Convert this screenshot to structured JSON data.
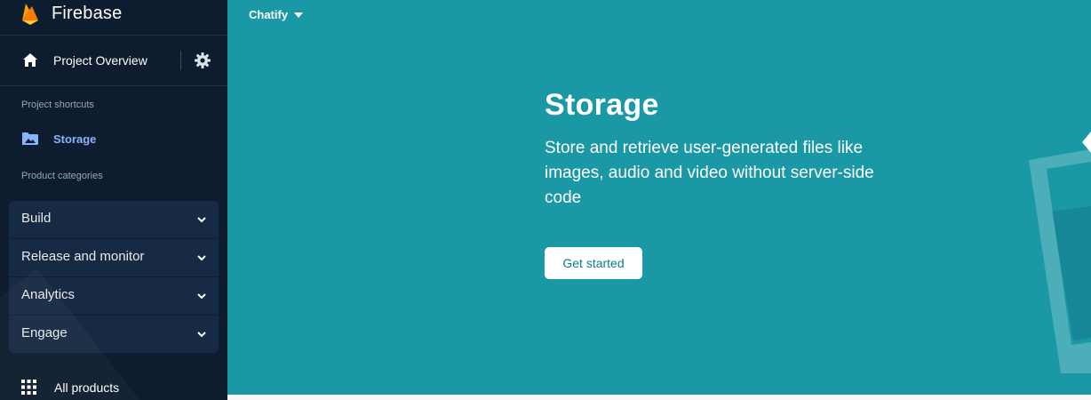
{
  "brand": {
    "name": "Firebase",
    "logo_icon": "firebase-flame-icon"
  },
  "nav": {
    "project_overview": {
      "label": "Project Overview",
      "icon": "home-icon",
      "settings_icon": "gear-icon"
    },
    "shortcuts_title": "Project shortcuts",
    "shortcuts": [
      {
        "label": "Storage",
        "icon": "folder-image-icon"
      }
    ],
    "categories_title": "Product categories",
    "categories": [
      {
        "label": "Build"
      },
      {
        "label": "Release and monitor"
      },
      {
        "label": "Analytics"
      },
      {
        "label": "Engage"
      }
    ],
    "all_products": {
      "label": "All products",
      "icon": "apps-grid-icon"
    }
  },
  "header": {
    "project_name": "Chatify"
  },
  "hero": {
    "title": "Storage",
    "description": "Store and retrieve user-generated files like images, audio and video without server-side code",
    "cta_label": "Get started"
  },
  "colors": {
    "sidebar_bg": "#0d1c2e",
    "main_bg": "#1a98a6",
    "active_link": "#8ab4f8",
    "cta_text": "#0b7d8b"
  }
}
